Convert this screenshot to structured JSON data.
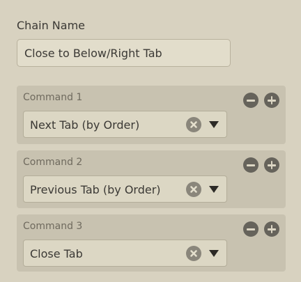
{
  "chain": {
    "label": "Chain Name",
    "value": "Close to Below/Right Tab"
  },
  "commands": [
    {
      "label": "Command 1",
      "value": "Next Tab (by Order)"
    },
    {
      "label": "Command 2",
      "value": "Previous Tab (by Order)"
    },
    {
      "label": "Command 3",
      "value": "Close Tab"
    }
  ],
  "icons": {
    "remove": "minus-circle-icon",
    "add": "plus-circle-icon",
    "clear": "x-circle-icon",
    "dropdown": "triangle-down-icon"
  },
  "colors": {
    "background": "#d8d2c0",
    "panel": "#c8c2b0",
    "field": "#dcd7c4",
    "button": "#66635b"
  }
}
